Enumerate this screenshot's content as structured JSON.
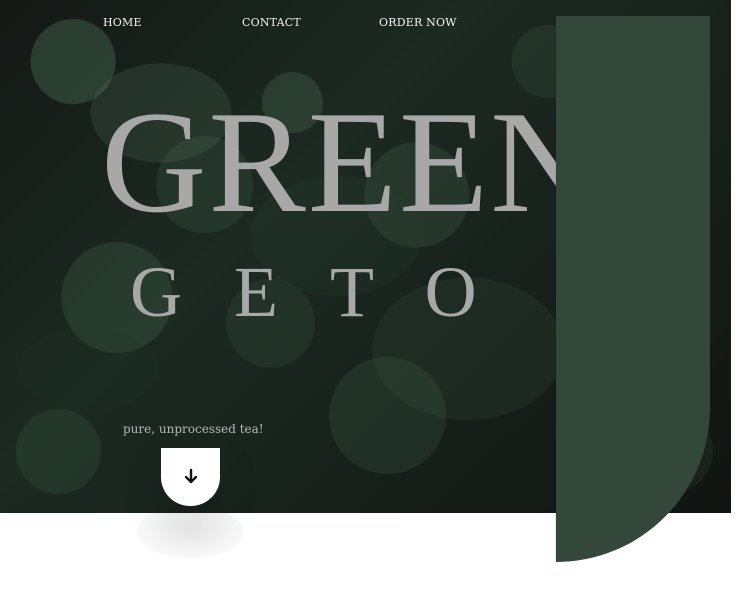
{
  "nav": {
    "items": [
      {
        "label": "HOME"
      },
      {
        "label": "CONTACT"
      },
      {
        "label": "ORDER NOW"
      }
    ]
  },
  "hero": {
    "title": "GREEN",
    "subtitle": "GETO",
    "tagline": "pure, unprocessed tea!"
  },
  "icons": {
    "scroll": "arrow-down-icon"
  },
  "colors": {
    "hero_background": "#1a211d",
    "headline_text": "#a8a8a8",
    "accent_panel": "#33483a",
    "button_background": "#ffffff",
    "nav_text": "#f2f2f2"
  }
}
